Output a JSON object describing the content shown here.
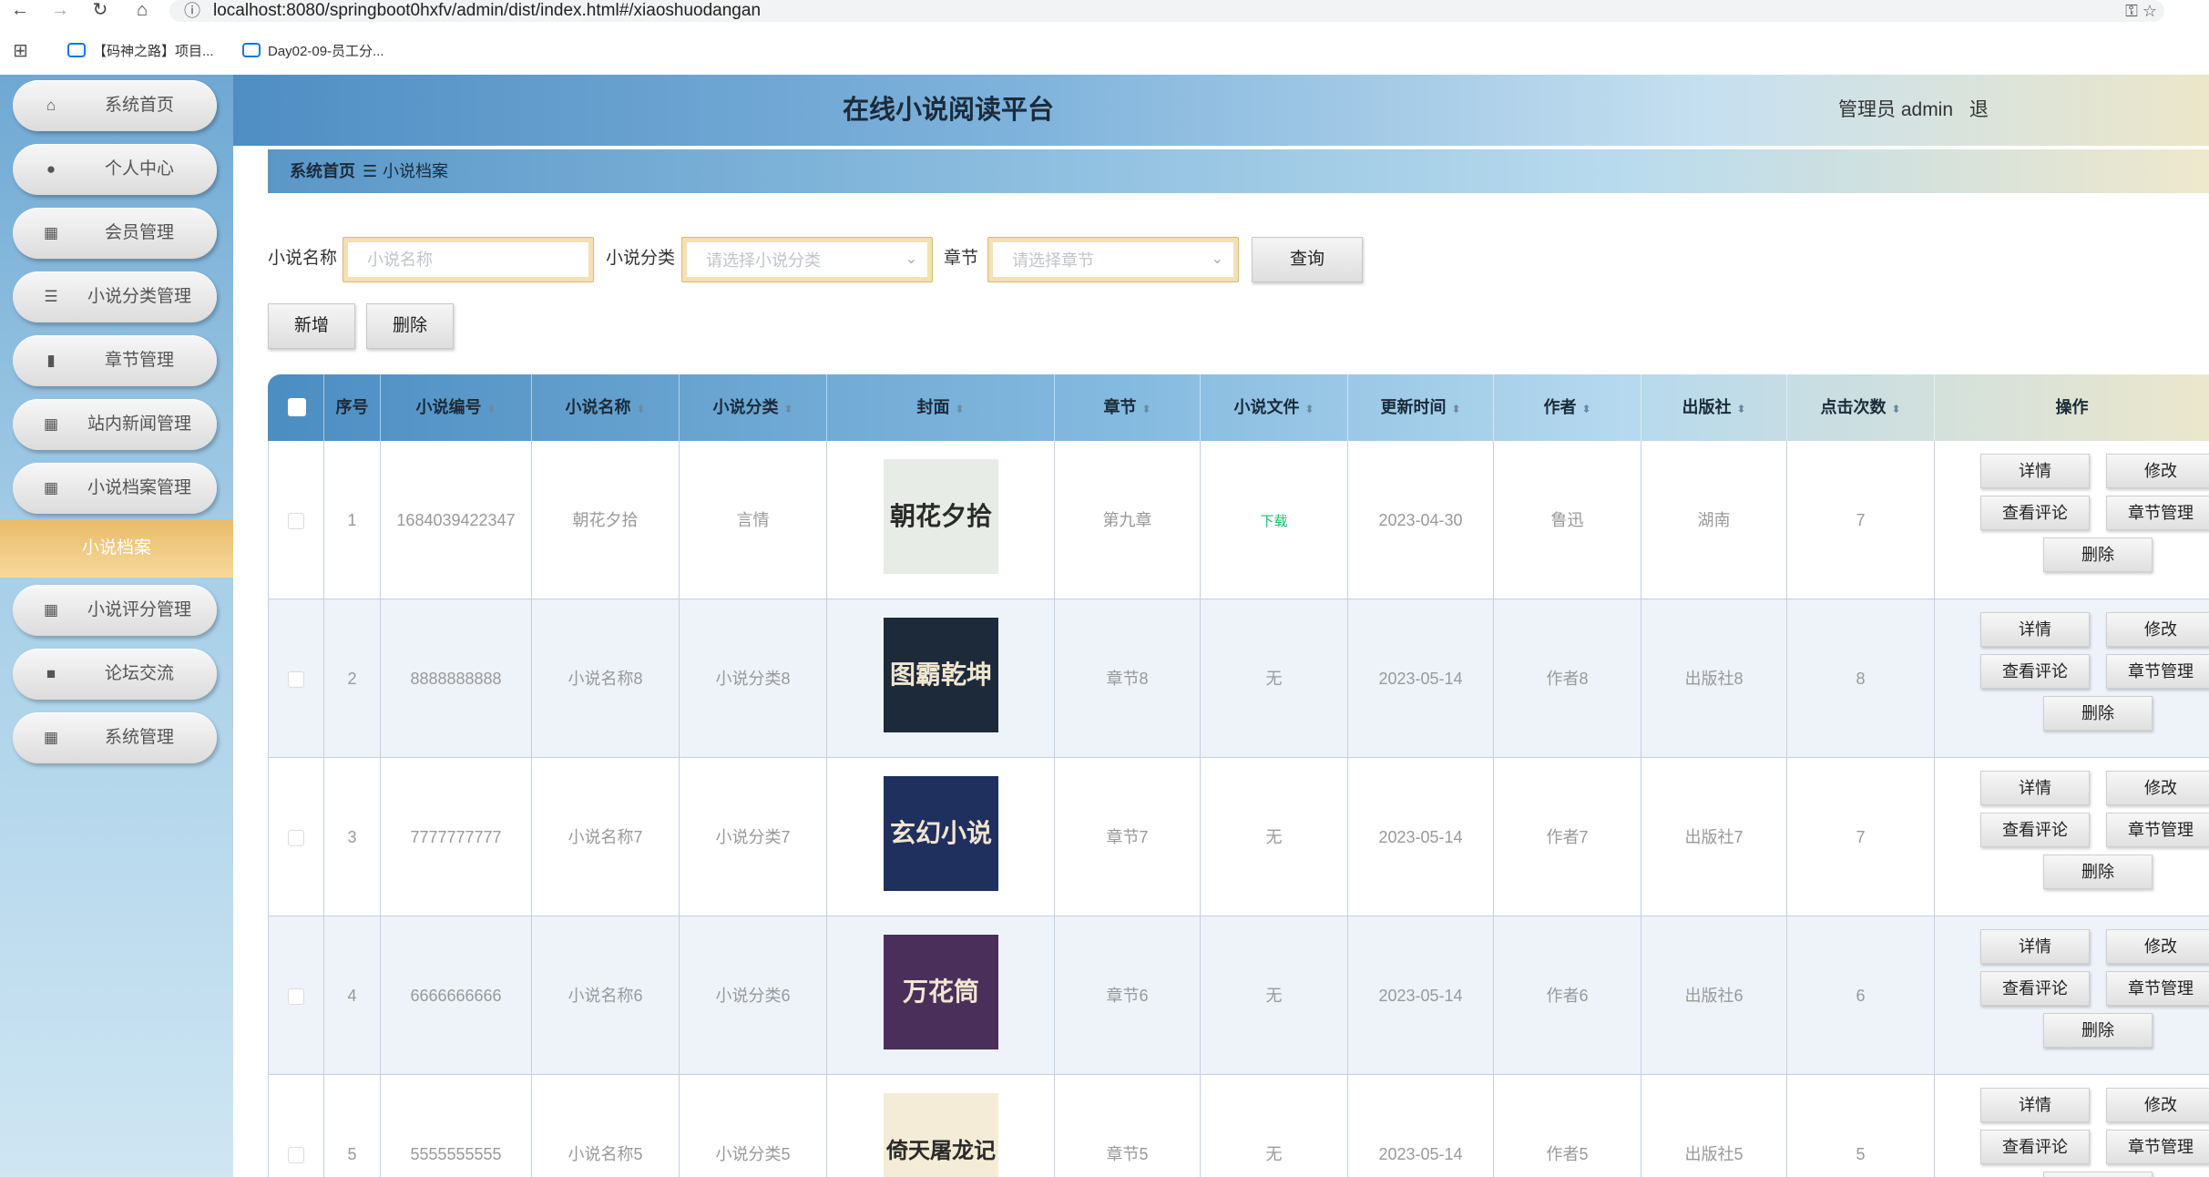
{
  "browser": {
    "url": "localhost:8080/springboot0hxfv/admin/dist/index.html#/xiaoshuodangan",
    "bookmarks": [
      "【码神之路】项目...",
      "Day02-09-员工分..."
    ]
  },
  "app": {
    "title": "在线小说阅读平台",
    "admin_label": "管理员 admin",
    "logout_partial": "退"
  },
  "sidebar": {
    "items": [
      {
        "label": "系统首页",
        "icon": "home-icon"
      },
      {
        "label": "个人中心",
        "icon": "user-icon"
      },
      {
        "label": "会员管理",
        "icon": "grid-icon"
      },
      {
        "label": "小说分类管理",
        "icon": "sliders-icon"
      },
      {
        "label": "章节管理",
        "icon": "books-icon"
      },
      {
        "label": "站内新闻管理",
        "icon": "grid-icon"
      },
      {
        "label": "小说档案管理",
        "icon": "grid-icon"
      },
      {
        "label": "小说评分管理",
        "icon": "grid-icon"
      },
      {
        "label": "论坛交流",
        "icon": "chat-icon"
      },
      {
        "label": "系统管理",
        "icon": "grid-icon"
      }
    ],
    "active_sub": "小说档案"
  },
  "breadcrumb": {
    "home": "系统首页",
    "separator": "☰",
    "current": "小说档案"
  },
  "search": {
    "name_label": "小说名称",
    "name_placeholder": "小说名称",
    "category_label": "小说分类",
    "category_placeholder": "请选择小说分类",
    "chapter_label": "章节",
    "chapter_placeholder": "请选择章节",
    "query_button": "查询"
  },
  "actions": {
    "add": "新增",
    "delete": "删除"
  },
  "table": {
    "headers": [
      "序号",
      "小说编号",
      "小说名称",
      "小说分类",
      "封面",
      "章节",
      "小说文件",
      "更新时间",
      "作者",
      "出版社",
      "点击次数",
      "操作"
    ],
    "ops": {
      "detail": "详情",
      "edit": "修改",
      "comments": "查看评论",
      "chapters": "章节管理",
      "delete": "删除"
    },
    "rows": [
      {
        "idx": "1",
        "no": "1684039422347",
        "name": "朝花夕拾",
        "category": "言情",
        "chapter": "第九章",
        "file": "下载",
        "date": "2023-04-30",
        "author": "鲁迅",
        "publisher": "湖南",
        "clicks": "7",
        "cover_text": "朝花夕拾",
        "cover_bg": "#e8ece6"
      },
      {
        "idx": "2",
        "no": "8888888888",
        "name": "小说名称8",
        "category": "小说分类8",
        "chapter": "章节8",
        "file": "无",
        "date": "2023-05-14",
        "author": "作者8",
        "publisher": "出版社8",
        "clicks": "8",
        "cover_text": "图霸乾坤",
        "cover_bg": "#1d2a3a"
      },
      {
        "idx": "3",
        "no": "7777777777",
        "name": "小说名称7",
        "category": "小说分类7",
        "chapter": "章节7",
        "file": "无",
        "date": "2023-05-14",
        "author": "作者7",
        "publisher": "出版社7",
        "clicks": "7",
        "cover_text": "玄幻小说",
        "cover_bg": "#1f2f5e"
      },
      {
        "idx": "4",
        "no": "6666666666",
        "name": "小说名称6",
        "category": "小说分类6",
        "chapter": "章节6",
        "file": "无",
        "date": "2023-05-14",
        "author": "作者6",
        "publisher": "出版社6",
        "clicks": "6",
        "cover_text": "万花筒",
        "cover_bg": "#4a2f5a"
      },
      {
        "idx": "5",
        "no": "5555555555",
        "name": "小说名称5",
        "category": "小说分类5",
        "chapter": "章节5",
        "file": "无",
        "date": "2023-05-14",
        "author": "作者5",
        "publisher": "出版社5",
        "clicks": "5",
        "cover_text": "倚天屠龙记",
        "cover_bg": "#f4ecd6"
      }
    ]
  },
  "colors": {
    "accent_gold": "#e9bb6a",
    "header_blue": "#4f8ec3",
    "download_green": "#19be6b"
  }
}
